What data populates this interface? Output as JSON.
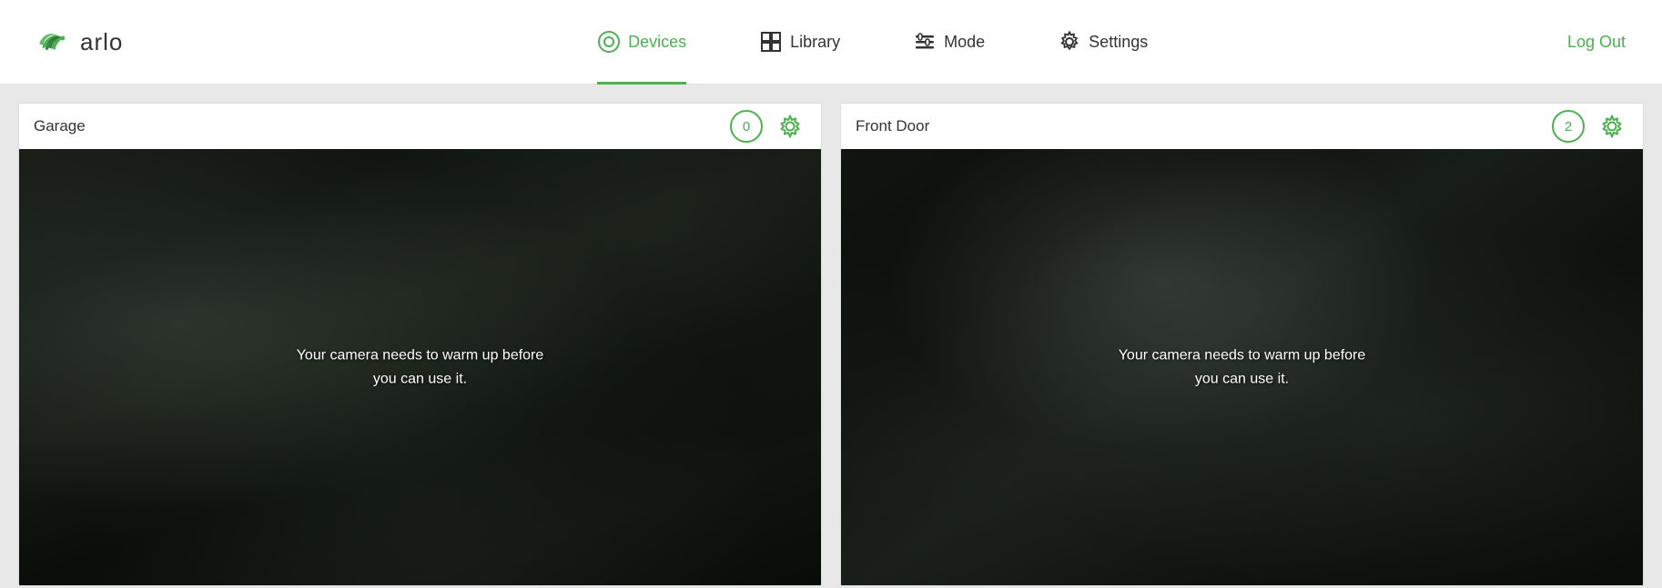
{
  "header": {
    "logo_text": "arlo",
    "logout_label": "Log Out"
  },
  "nav": {
    "items": [
      {
        "id": "devices",
        "label": "Devices",
        "active": true
      },
      {
        "id": "library",
        "label": "Library",
        "active": false
      },
      {
        "id": "mode",
        "label": "Mode",
        "active": false
      },
      {
        "id": "settings",
        "label": "Settings",
        "active": false
      }
    ]
  },
  "cameras": [
    {
      "id": "garage",
      "title": "Garage",
      "badge": "0",
      "warmup_text": "Your camera needs to warm up before you can use it."
    },
    {
      "id": "front-door",
      "title": "Front Door",
      "badge": "2",
      "warmup_text": "Your camera needs to warm up before you can use it."
    }
  ],
  "icons": {
    "devices_circle": "○",
    "library_grid": "▦",
    "mode_sliders": "≡",
    "settings_gear": "⚙"
  }
}
